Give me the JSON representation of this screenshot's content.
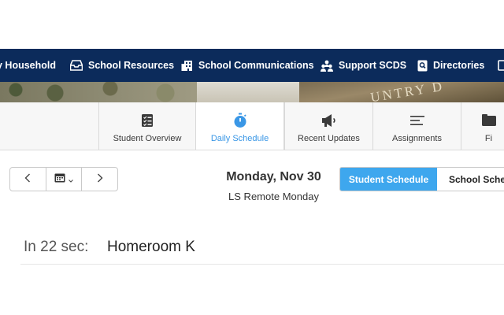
{
  "topnav": {
    "items": [
      {
        "label": "y Household",
        "icon": "household-icon"
      },
      {
        "label": "School Resources",
        "icon": "inbox-tray-icon"
      },
      {
        "label": "School Communications",
        "icon": "building-icon"
      },
      {
        "label": "Support SCDS",
        "icon": "people-group-icon"
      },
      {
        "label": "Directories",
        "icon": "search-book-icon"
      },
      {
        "label": "",
        "icon": "truncated-icon"
      }
    ],
    "background": "#0c2b5b"
  },
  "banner": {
    "sign_text": "UNTRY D"
  },
  "tabs": [
    {
      "label": "Student Overview",
      "icon": "checklist-icon",
      "active": false
    },
    {
      "label": "Daily Schedule",
      "icon": "stopwatch-icon",
      "active": true
    },
    {
      "label": "Recent Updates",
      "icon": "megaphone-icon",
      "active": false
    },
    {
      "label": "Assignments",
      "icon": "lines-icon",
      "active": false
    },
    {
      "label": "Fi",
      "icon": "folder-icon",
      "active": false
    }
  ],
  "date_nav": {
    "prev_icon": "chevron-left-icon",
    "calendar_icon": "calendar-icon",
    "next_icon": "chevron-right-icon"
  },
  "schedule": {
    "date": "Monday, Nov 30",
    "day_name": "LS Remote Monday",
    "toggle": {
      "selected": "Student Schedule",
      "other": "School Schedu"
    },
    "next_up": {
      "countdown": "In 22 sec:",
      "class_name": "Homeroom K"
    }
  },
  "colors": {
    "accent": "#3ea7ee",
    "active_tab_text": "#3a97e6",
    "nav_bg": "#0c2b5b"
  }
}
